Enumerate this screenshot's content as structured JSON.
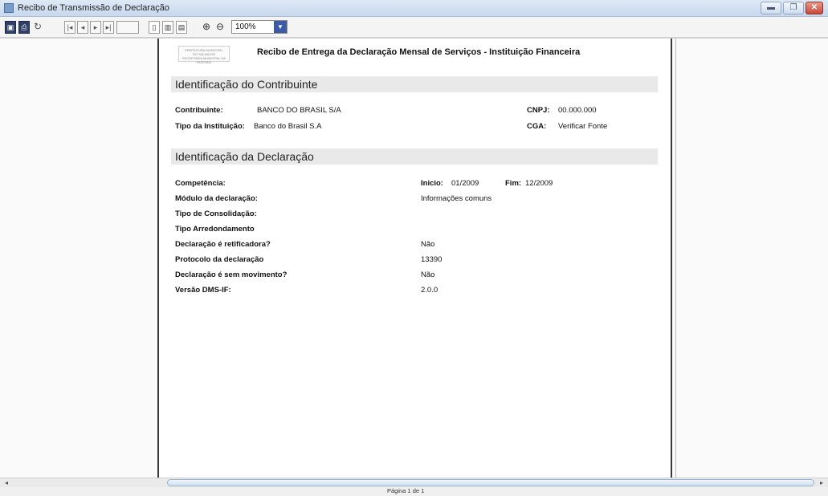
{
  "window": {
    "title": "Recibo de Transmissão de Declaração"
  },
  "toolbar": {
    "zoom": "100%"
  },
  "document": {
    "logo_lines": [
      "PREFEITURA MUNICIPAL",
      "DO SALVADOR",
      "SECRETARIA MUNICIPAL DA FAZENDA"
    ],
    "title": "Recibo de Entrega da Declaração Mensal de Serviços  -  Instituição Financeira",
    "section1": {
      "heading": "Identificação do Contribuinte",
      "contribuinte_label": "Contribuinte:",
      "contribuinte_value": "BANCO DO BRASIL S/A",
      "cnpj_label": "CNPJ:",
      "cnpj_value": "00.000.000",
      "tipo_label": "Tipo da Instituição:",
      "tipo_value": "Banco do Brasil S.A",
      "cga_label": "CGA:",
      "cga_value": "Verificar Fonte"
    },
    "section2": {
      "heading": "Identificação da Declaração",
      "competencia_label": "Competência:",
      "inicio_label": "Inicio:",
      "inicio_value": "01/2009",
      "fim_label": "Fim:",
      "fim_value": "12/2009",
      "rows": [
        {
          "label": "Módulo da declaração:",
          "value": "Informações comuns"
        },
        {
          "label": "Tipo de Consolidação:",
          "value": ""
        },
        {
          "label": "Tipo Arredondamento",
          "value": ""
        },
        {
          "label": "Declaração é retificadora?",
          "value": "Não"
        },
        {
          "label": "Protocolo da declaração",
          "value": "13390"
        },
        {
          "label": "Declaração é sem movimento?",
          "value": "Não"
        },
        {
          "label": "Versão DMS-IF:",
          "value": "2.0.0"
        }
      ]
    }
  },
  "status": {
    "page": "Página 1 de 1"
  }
}
